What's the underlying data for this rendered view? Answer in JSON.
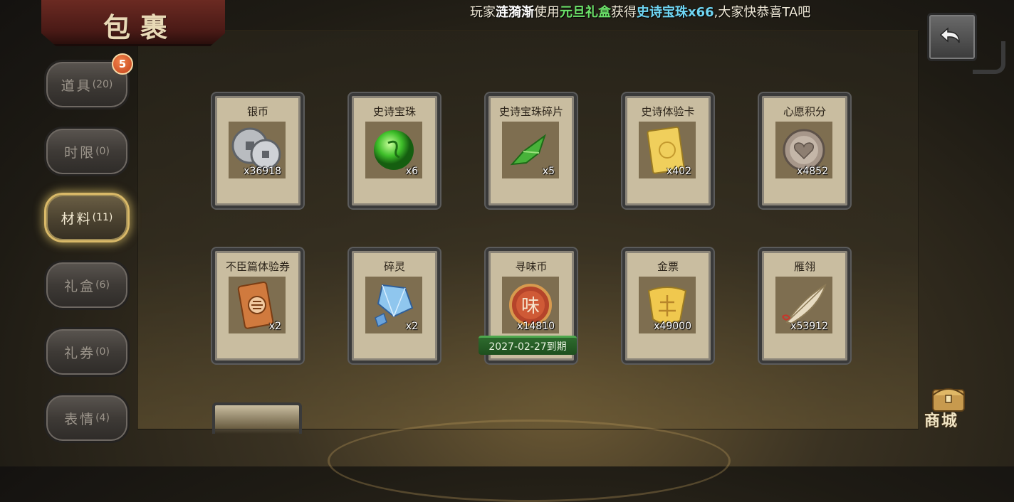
{
  "header": {
    "title": "包裹"
  },
  "announcement": {
    "prefix": "玩家",
    "player": "涟漪渐",
    "middle1": "使用",
    "source_item": "元旦礼盒",
    "middle2": "获得",
    "reward": "史诗宝珠x66",
    "suffix": ",大家快恭喜TA吧"
  },
  "sidebar": {
    "badge": "5",
    "tabs": [
      {
        "label": "道具",
        "count": "(20)",
        "active": false
      },
      {
        "label": "时限",
        "count": "(0)",
        "active": false
      },
      {
        "label": "材料",
        "count": "(11)",
        "active": true
      },
      {
        "label": "礼盒",
        "count": "(6)",
        "active": false
      },
      {
        "label": "礼券",
        "count": "(0)",
        "active": false
      },
      {
        "label": "表情",
        "count": "(4)",
        "active": false
      }
    ]
  },
  "items": [
    {
      "name": "银币",
      "qty": "x36918",
      "icon": "silver-coin-icon"
    },
    {
      "name": "史诗宝珠",
      "qty": "x6",
      "icon": "epic-pearl-icon"
    },
    {
      "name": "史诗宝珠碎片",
      "qty": "x5",
      "icon": "pearl-fragment-icon"
    },
    {
      "name": "史诗体验卡",
      "qty": "x402",
      "icon": "trial-card-icon"
    },
    {
      "name": "心愿积分",
      "qty": "x4852",
      "icon": "wish-point-icon"
    },
    {
      "name": "不臣篇体验券",
      "qty": "x2",
      "icon": "ticket-icon"
    },
    {
      "name": "碎灵",
      "qty": "x2",
      "icon": "crystal-icon"
    },
    {
      "name": "寻味币",
      "qty": "x14810",
      "icon": "flavor-coin-icon",
      "expiry": "2027-02-27到期"
    },
    {
      "name": "金票",
      "qty": "x49000",
      "icon": "gold-ticket-icon"
    },
    {
      "name": "雁翎",
      "qty": "x53912",
      "icon": "feather-icon"
    }
  ],
  "flavor_coin_glyph": "味",
  "shop": {
    "label": "商城"
  },
  "colors": {
    "active_glow": "#d9b968",
    "badge": "#c2401b",
    "ticker_green": "#6ce36a",
    "ticker_blue": "#6fd5f2",
    "expiry_bg": "#2d6a2d"
  }
}
